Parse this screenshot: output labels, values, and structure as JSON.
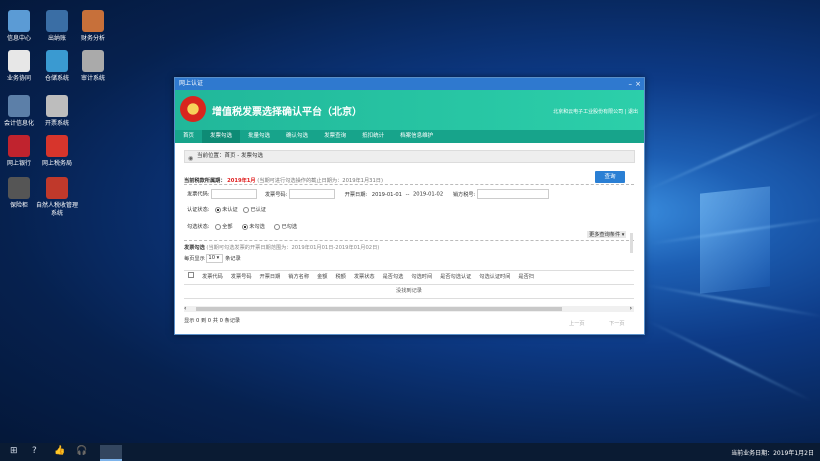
{
  "desktop": {
    "icons": [
      {
        "label": "信息中心",
        "color": "#5b9bd5"
      },
      {
        "label": "出纳账",
        "color": "#3a6ea5"
      },
      {
        "label": "财务分析",
        "color": "#c7703a"
      },
      {
        "label": "业务协同",
        "color": "#e7e7e7"
      },
      {
        "label": "仓储系统",
        "color": "#3a9ad1"
      },
      {
        "label": "审计系统",
        "color": "#aaaaaa"
      },
      {
        "label": "会计信息化",
        "color": "#5c7fa8"
      },
      {
        "label": "开票系统",
        "color": "#bdbdbd"
      },
      {
        "label": "网上银行",
        "color": "#c0232e"
      },
      {
        "label": "网上税务局",
        "color": "#d7352c"
      },
      {
        "label": "保险柜",
        "color": "#555555"
      },
      {
        "label": "自然人税收管理系统",
        "color": "#c0392b"
      }
    ]
  },
  "window": {
    "title": "网上认证",
    "minimize": "–",
    "close": "×",
    "platform_title": "增值税发票选择确认平台（北京）",
    "company": "北京和云电子工业股份有限公司 | 退出",
    "nav": [
      "首页",
      "发票勾选",
      "批量勾选",
      "确认勾选",
      "发票查询",
      "抵扣统计",
      "档案信息维护"
    ],
    "breadcrumb": "当前位置：首页 - 发票勾选",
    "period_label": "当前税款所属期：",
    "period_value": "2019年1月",
    "period_note": "(当期可进行勾选操作的截止日期为：2019年1月31日)",
    "query_button": "查询",
    "filter": {
      "invoice_code": "发票代码:",
      "invoice_no": "发票号码:",
      "date_label": "开票日期:",
      "date_from": "2019-01-01",
      "date_sep": "--",
      "date_to": "2019-01-02",
      "seller_tax": "销方税号:",
      "auth_status": "认证状态:",
      "auth_opt1": "未认证",
      "auth_opt2": "已认证",
      "select_status": "勾选状态:",
      "sel_all": "全部",
      "sel_unchecked": "未勾选",
      "sel_checked": "已勾选",
      "more": "更多查询条件 ▾"
    },
    "section_title": "发票勾选",
    "section_note": "(当期可勾选发票的开票日期范围为：2019年01月01日-2019年01月02日)",
    "page_size_pre": "每页显示",
    "page_size": "10",
    "page_size_post": "条记录",
    "table_headers": [
      "发票代码",
      "发票号码",
      "开票日期",
      "销方名称",
      "金额",
      "税额",
      "发票状态",
      "是否勾选",
      "勾选时间",
      "是否勾选认证",
      "勾选认证时间",
      "是否扫"
    ],
    "empty_text": "没找到记录",
    "footer_info": "显示 0 到 0 共 0 条记录",
    "prev": "上一页",
    "next": "下一页"
  },
  "taskbar": {
    "date_text": "当前业务日期：2019年1月2日"
  }
}
